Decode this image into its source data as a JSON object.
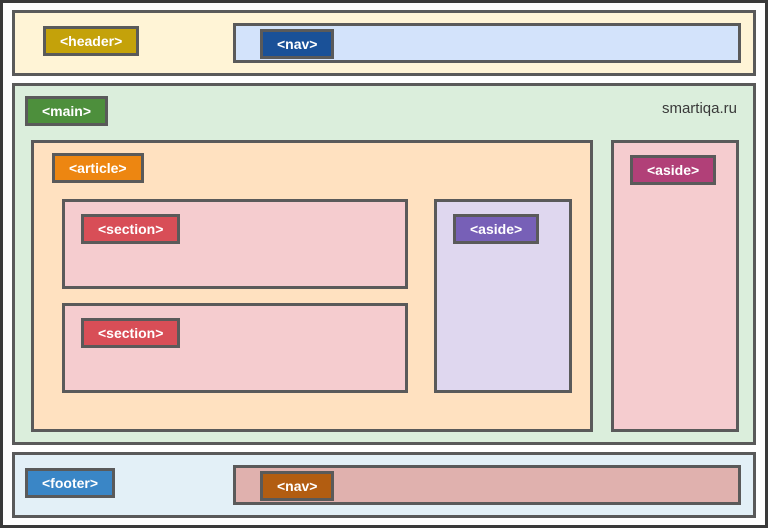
{
  "watermark": "smartiqa.ru",
  "header": {
    "label": "<header>",
    "nav": {
      "label": "<nav>"
    }
  },
  "main": {
    "label": "<main>",
    "article": {
      "label": "<article>",
      "sections": [
        {
          "label": "<section>"
        },
        {
          "label": "<section>"
        }
      ],
      "aside": {
        "label": "<aside>"
      }
    },
    "aside": {
      "label": "<aside>"
    }
  },
  "footer": {
    "label": "<footer>",
    "nav": {
      "label": "<nav>"
    }
  }
}
